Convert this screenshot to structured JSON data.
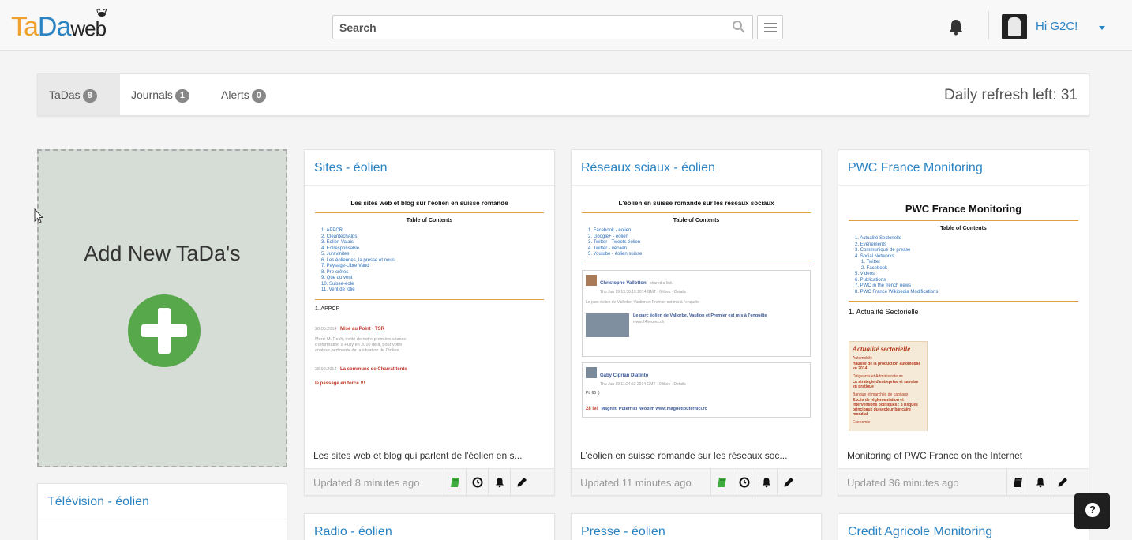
{
  "app": {
    "logo_ta": "Ta",
    "logo_da": "Da",
    "logo_web": "web"
  },
  "topbar": {
    "search_placeholder": "Search",
    "greeting": "Hi G2C!"
  },
  "tabs": [
    {
      "label": "TaDas",
      "count": "8"
    },
    {
      "label": "Journals",
      "count": "1"
    },
    {
      "label": "Alerts",
      "count": "0"
    }
  ],
  "daily_refresh": "Daily refresh left: 31",
  "add_new": {
    "label": "Add New TaDa's"
  },
  "cards": [
    {
      "title": "Sites - éolien",
      "description": "Les sites web et blog qui parlent de l'éolien en s...",
      "updated": "Updated 8 minutes ago",
      "thumb": {
        "heading": "Les sites web et blog sur l'éolien en suisse romande",
        "toc": "Table of Contents",
        "items": [
          "1. APPCR",
          "2. CleantechAlps",
          "3. Eolien Valais",
          "4. Eolresponsable",
          "5. Juravinites",
          "6. Les éoliennes, la presse et nous",
          "7. Paysage-Libre Vaud",
          "8. Pro-crêtes",
          "9. Que du vent",
          "10. Suisse-eole",
          "11. Vent de folie"
        ],
        "section": "1. APPCR",
        "post1_date": "26.05.2014",
        "post1_title": "Mise au Point - TSR",
        "post1_text": "Merci M. Roch, invité de notre première séance d'information à Fully en 2010 déjà, pour votre analyse pertinente de la situation de l'éolien...",
        "post2_date": "28.02.2014",
        "post2_title": "La commune de Charrat tente le passage en force !!!"
      }
    },
    {
      "title": "Réseaux sciaux - éolien",
      "description": "L'éolien en suisse romande sur les réseaux soc...",
      "updated": "Updated 11 minutes ago",
      "thumb": {
        "heading": "L'éolien en suisse romande sur les réseaux sociaux",
        "toc": "Table of Contents",
        "items": [
          "1. Facebook - éolien",
          "2. Google+ - éolien",
          "3. Twitter - Tweets éolien",
          "4. Twitter - #éolien",
          "5. Youtube - éolien suisse"
        ],
        "fb1_name": "Christophe Vallotton",
        "fb1_action": "shared a link.",
        "fb1_meta": "Thu Jun 19 13:36:15 2014 GMT · 0 likes · Details",
        "fb1_text": "Le parc éolien de Vallorbe, Vaulion et Premier est mis à l'enquête",
        "fb1_link": "Le parc éolien de Vallorbe, Vaulion et Premier est mis à l'enquête",
        "fb1_site": "www.24heures.ch",
        "fb2_name": "Gaby Ciprian Diatinto",
        "fb2_meta": "Thu Jun 19 11:24:53 2014 GMT · 0 likes · Details",
        "fb2_text": "Pt. 66 :)",
        "fb2_price": "28 lei",
        "fb2_link": "Magneti Puternici Neodim www.magnetiputernici.ro"
      }
    },
    {
      "title": "PWC France Monitoring",
      "description": "Monitoring of PWC France on the Internet",
      "updated": "Updated 36 minutes ago",
      "thumb": {
        "heading": "PWC France Monitoring",
        "toc": "Table of Contents",
        "items": [
          "1. Actualité Sectorielle",
          "2. Evénements",
          "3. Communiqué de presse",
          "4. Social Networks",
          "   1. Twitter",
          "   2. Facebook",
          "5. Videos",
          "6. Publications",
          "7. PWC in the french news",
          "8. PWC France Wikipedia Modifications"
        ],
        "section": "1. Actualité Sectorielle",
        "art_title": "Actualité sectorielle",
        "art_lines": [
          "Automobile",
          "Hausse de la production automobile en 2014",
          "Dirigeants et Administrateurs",
          "La stratégie d'entreprise et sa mise en pratique",
          "Banque et marchés de capitaux",
          "Excès de réglementation et interventions politiques : 3 risques principaux du secteur bancaire mondial",
          "Economie"
        ]
      }
    }
  ],
  "lower_cards": [
    {
      "title": "Télévision - éolien"
    },
    {
      "title": "Radio - éolien"
    },
    {
      "title": "Presse - éolien"
    },
    {
      "title": "Credit Agricole Monitoring"
    }
  ],
  "help_label": "?",
  "colors": {
    "brand_blue": "#2b83c2",
    "brand_orange": "#f0a02c",
    "add_green": "#57a84a",
    "journal_icon_green": "#3fae3f"
  }
}
